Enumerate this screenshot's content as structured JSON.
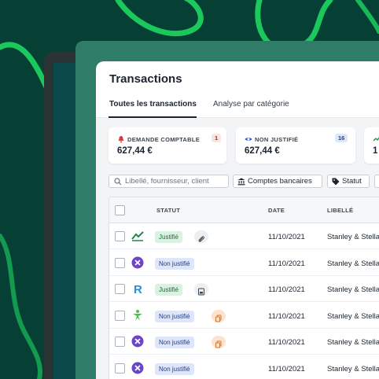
{
  "page": {
    "title": "Transactions",
    "tabs": [
      "Toutes les transactions",
      "Analyse par catégorie"
    ]
  },
  "summary_cards": [
    {
      "label": "DEMANDE COMPTABLE",
      "value": "627,44 €",
      "count": "1",
      "icon": "bell-icon"
    },
    {
      "label": "NON JUSTIFIÉ",
      "value": "627,44 €",
      "count": "16",
      "icon": "eye-icon"
    },
    {
      "label": "",
      "value": "1",
      "count": "",
      "icon": "trend-icon"
    }
  ],
  "filters": {
    "search_placeholder": "Libellé, fournisseur, client",
    "accounts_label": "Comptes bancaires",
    "status_label": "Statut"
  },
  "table": {
    "headers": {
      "statut": "STATUT",
      "date": "DATE",
      "libelle": "LIBELLÉ"
    },
    "rows": [
      {
        "merchant_icon": "chart-logo-icon",
        "status": "Justifié",
        "attachment": "paperclip-icon",
        "date": "11/10/2021",
        "label": "Stanley & Stella"
      },
      {
        "merchant_icon": "x-logo-icon",
        "status": "Non justifié",
        "attachment": "",
        "date": "11/10/2021",
        "label": "Stanley & Stella"
      },
      {
        "merchant_icon": "r-logo-icon",
        "status": "Justifié",
        "attachment": "document-icon",
        "date": "11/10/2021",
        "label": "Stanley & Stella"
      },
      {
        "merchant_icon": "star-figure-icon",
        "status": "Non justifié",
        "attachment": "copy-icon",
        "date": "11/10/2021",
        "label": "Stanley & Stella"
      },
      {
        "merchant_icon": "x-logo-icon",
        "status": "Non justifié",
        "attachment": "copy-icon",
        "date": "11/10/2021",
        "label": "Stanley & Stella"
      },
      {
        "merchant_icon": "x-logo-icon",
        "status": "Non justifié",
        "attachment": "",
        "date": "11/10/2021",
        "label": "Stanley & Stella"
      }
    ]
  },
  "colors": {
    "background": "#063f33",
    "accent_green": "#1ed760",
    "justified_bg": "#d9f2e1",
    "unjustified_bg": "#dde6fb",
    "copy_icon_bg": "#fde3cf"
  }
}
